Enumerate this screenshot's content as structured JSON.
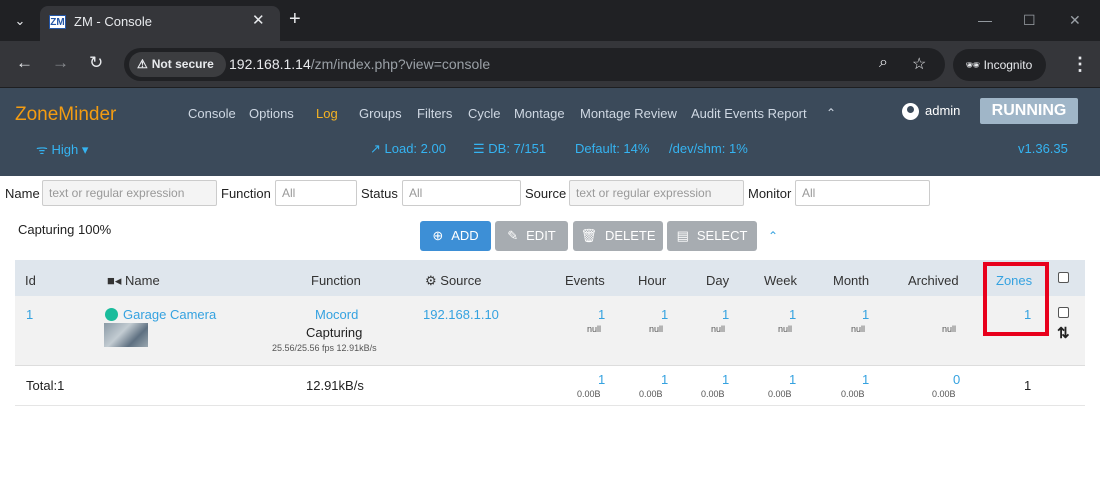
{
  "browser": {
    "tab_title": "ZM - Console",
    "tab_favicon": "ZM",
    "not_secure": "Not secure",
    "url_host": "192.168.1.14",
    "url_path": "/zm/index.php?view=console",
    "incognito": "Incognito"
  },
  "zm": {
    "logo": "ZoneMinder",
    "menu": [
      "Console",
      "Options",
      "Log",
      "Groups",
      "Filters",
      "Cycle",
      "Montage",
      "Montage Review",
      "Audit Events Report"
    ],
    "active_menu": "Log",
    "user": "admin",
    "state": "RUNNING",
    "bandwidth": "High",
    "load": "Load: 2.00",
    "db": "DB: 7/151",
    "default": "Default: 14%",
    "shm": "/dev/shm: 1%",
    "version": "v1.36.35"
  },
  "filters": {
    "name_label": "Name",
    "name_placeholder": "text or regular expression",
    "function_label": "Function",
    "function_value": "All",
    "status_label": "Status",
    "status_value": "All",
    "source_label": "Source",
    "source_placeholder": "text or regular expression",
    "monitor_label": "Monitor",
    "monitor_value": "All"
  },
  "capturing": "Capturing 100%",
  "buttons": {
    "add": "ADD",
    "edit": "EDIT",
    "delete": "DELETE",
    "select": "SELECT"
  },
  "table": {
    "headers": {
      "id": "Id",
      "name": "Name",
      "function": "Function",
      "source": "Source",
      "events": "Events",
      "hour": "Hour",
      "day": "Day",
      "week": "Week",
      "month": "Month",
      "archived": "Archived",
      "zones": "Zones"
    },
    "row": {
      "id": "1",
      "name": "Garage Camera",
      "function": "Mocord",
      "status": "Capturing",
      "fps": "25.56/25.56 fps 12.91kB/s",
      "source": "192.168.1.10",
      "events": {
        "v": "1",
        "s": "null"
      },
      "hour": {
        "v": "1",
        "s": "null"
      },
      "day": {
        "v": "1",
        "s": "null"
      },
      "week": {
        "v": "1",
        "s": "null"
      },
      "month": {
        "v": "1",
        "s": "null"
      },
      "archived": "null",
      "zones": "1"
    },
    "totals": {
      "label": "Total:1",
      "bandwidth": "12.91kB/s",
      "events": {
        "v": "1",
        "s": "0.00B"
      },
      "hour": {
        "v": "1",
        "s": "0.00B"
      },
      "day": {
        "v": "1",
        "s": "0.00B"
      },
      "week": {
        "v": "1",
        "s": "0.00B"
      },
      "month": {
        "v": "1",
        "s": "0.00B"
      },
      "archived": {
        "v": "0",
        "s": "0.00B"
      },
      "zones": "1"
    }
  }
}
